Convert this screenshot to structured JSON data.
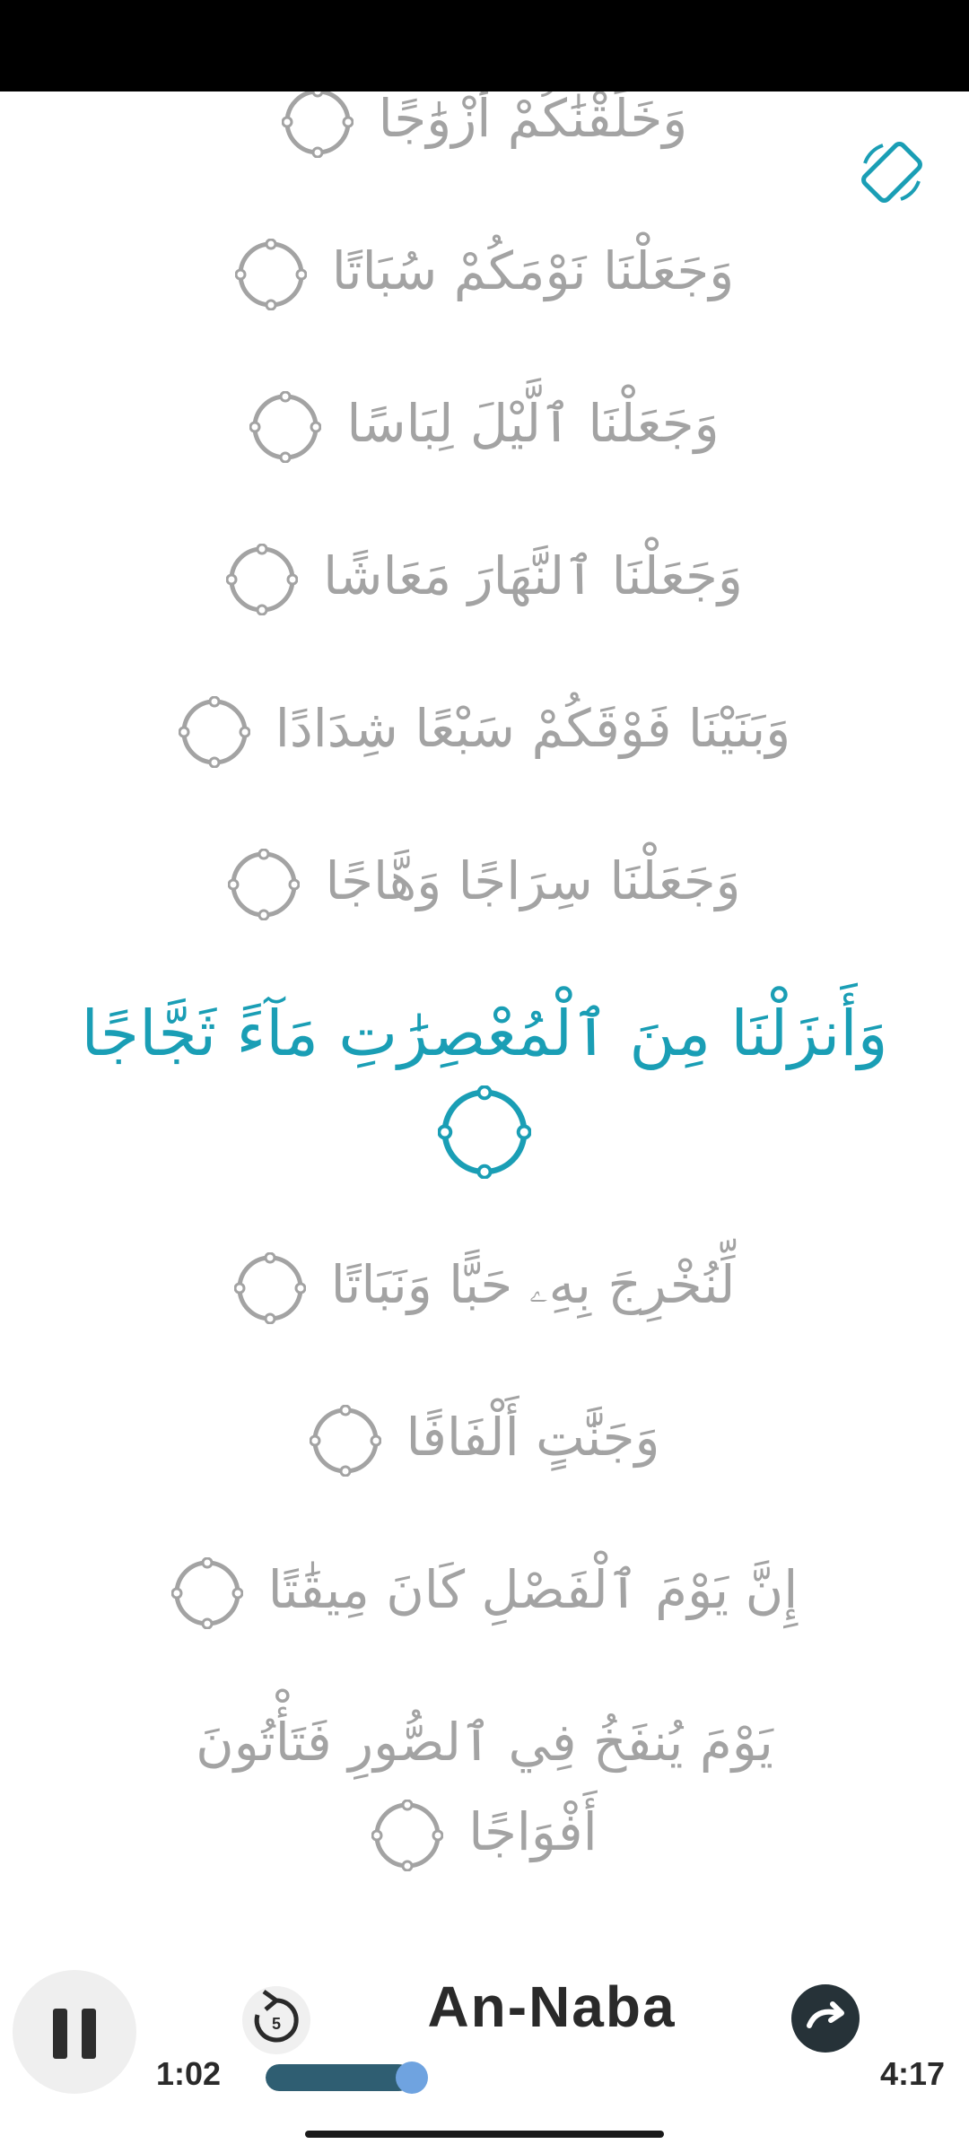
{
  "colors": {
    "accent": "#1a9eb5",
    "verse_text": "#a3a3a3",
    "progress_fill": "#2f5e72",
    "progress_knob": "#6fa3e0"
  },
  "top_controls": {
    "rotate_icon": "screen-rotation-icon"
  },
  "verses": [
    {
      "text": "وَخَلَقْنَٰكُمْ أَزْوَٰجًا",
      "active": false
    },
    {
      "text": "وَجَعَلْنَا نَوْمَكُمْ سُبَاتًا",
      "active": false
    },
    {
      "text": "وَجَعَلْنَا ٱلَّيْلَ لِبَاسًا",
      "active": false
    },
    {
      "text": "وَجَعَلْنَا ٱلنَّهَارَ مَعَاشًا",
      "active": false
    },
    {
      "text": "وَبَنَيْنَا فَوْقَكُمْ سَبْعًا شِدَادًا",
      "active": false
    },
    {
      "text": "وَجَعَلْنَا سِرَاجًا وَهَّاجًا",
      "active": false
    },
    {
      "text": "وَأَنزَلْنَا مِنَ ٱلْمُعْصِرَٰتِ مَآءً ثَجَّاجًا",
      "active": true
    },
    {
      "text": "لِّنُخْرِجَ بِهِۦ حَبًّا وَنَبَاتًا",
      "active": false
    },
    {
      "text": "وَجَنَّٰتٍ أَلْفَافًا",
      "active": false
    },
    {
      "text": "إِنَّ يَوْمَ ٱلْفَصْلِ كَانَ مِيقَٰتًا",
      "active": false
    },
    {
      "line1": "يَوْمَ يُنفَخُ فِي ٱلصُّورِ فَتَأْتُونَ",
      "line2": "أَفْوَاجًا",
      "active": false
    }
  ],
  "player": {
    "title": "An-Naba",
    "current_time": "1:02",
    "total_time": "4:17",
    "progress": 0.24,
    "replay_label": "5",
    "pause_icon": "pause-icon",
    "replay_icon": "replay-5-icon",
    "forward_icon": "forward-icon"
  }
}
